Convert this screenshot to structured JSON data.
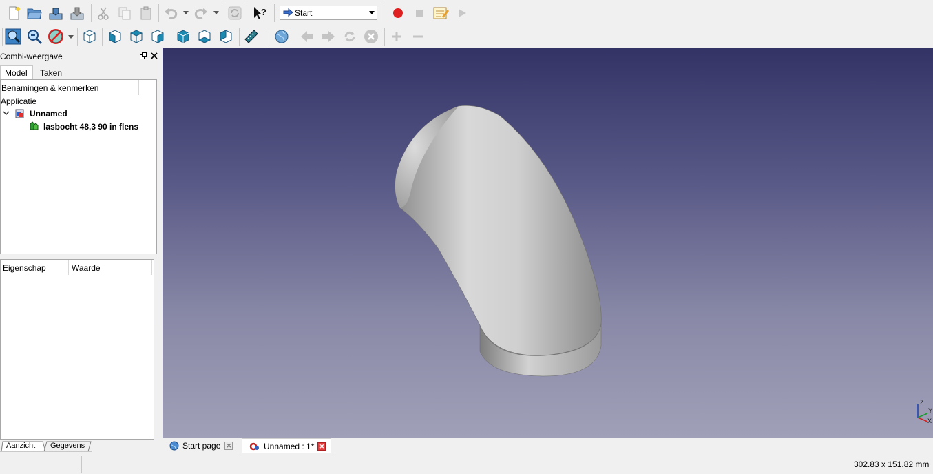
{
  "toolbar": {
    "workbench_selector": "Start"
  },
  "combi_panel": {
    "title": "Combi-weergave",
    "tabs": [
      "Model",
      "Taken"
    ],
    "tree_header": "Benamingen & kenmerken",
    "tree": {
      "root": "Applicatie",
      "document": "Unnamed",
      "object": "lasbocht 48,3 90 in flens"
    },
    "property_columns": [
      "Eigenschap",
      "Waarde"
    ],
    "bottom_tabs": [
      "Aanzicht",
      "Gegevens"
    ]
  },
  "document_tabs": [
    {
      "label": "Start page"
    },
    {
      "label": "Unnamed : 1*"
    }
  ],
  "axis": {
    "z": "Z",
    "y": "Y",
    "x": "X"
  },
  "status": {
    "dimensions": "302.83 x 151.82 mm"
  },
  "colors": {
    "viewport_top": "#333366",
    "viewport_bottom": "#a0a0b8",
    "record": "#e02020",
    "close_red": "#e04040"
  }
}
